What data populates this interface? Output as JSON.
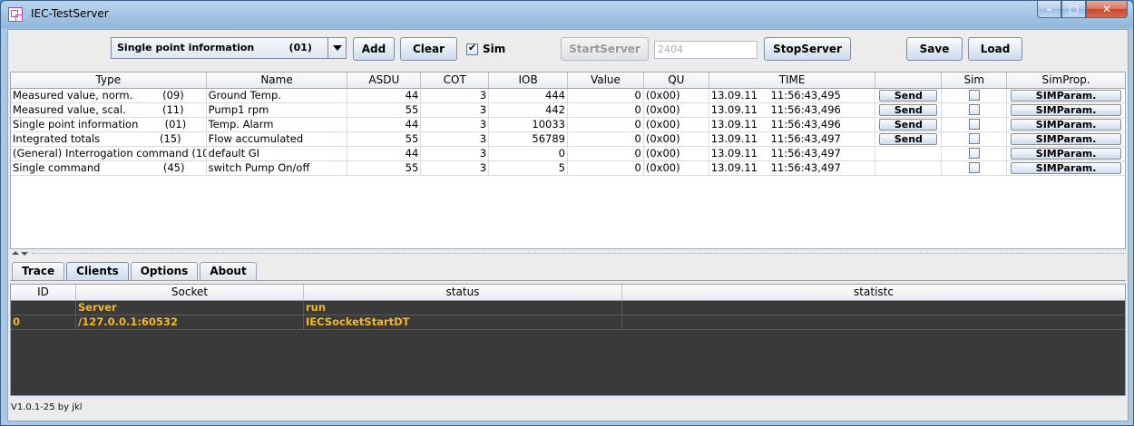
{
  "window": {
    "title": "IEC-TestServer",
    "controls": {
      "minimize": "–",
      "maximize": "□",
      "close": "✕"
    }
  },
  "toolbar": {
    "type_select": {
      "label": "Single point information",
      "code": "(01)"
    },
    "add_label": "Add",
    "clear_label": "Clear",
    "sim_label": "Sim",
    "sim_checked": true,
    "start_label": "StartServer",
    "port_value": "2404",
    "stop_label": "StopServer",
    "save_label": "Save",
    "load_label": "Load"
  },
  "table": {
    "headers": [
      "Type",
      "Name",
      "ASDU",
      "COT",
      "IOB",
      "Value",
      "QU",
      "TIME",
      "",
      "Sim",
      "SimProp."
    ],
    "rows": [
      {
        "type": "Measured value, norm.         (09)",
        "name": "Ground Temp.",
        "asdu": "44",
        "cot": "3",
        "iob": "444",
        "value": "0",
        "qu": "(0x00)",
        "time": "13.09.11    11:56:43,495",
        "send": "Send",
        "sim": false,
        "simprop": "SIMParam."
      },
      {
        "type": "Measured value, scal.           (11)",
        "name": "Pump1 rpm",
        "asdu": "55",
        "cot": "3",
        "iob": "442",
        "value": "0",
        "qu": "(0x00)",
        "time": "13.09.11    11:56:43,496",
        "send": "Send",
        "sim": false,
        "simprop": "SIMParam."
      },
      {
        "type": "Single point information        (01)",
        "name": "Temp. Alarm",
        "asdu": "44",
        "cot": "3",
        "iob": "10033",
        "value": "0",
        "qu": "(0x00)",
        "time": "13.09.11    11:56:43,496",
        "send": "Send",
        "sim": false,
        "simprop": "SIMParam."
      },
      {
        "type": "Integrated totals                  (15)",
        "name": "Flow accumulated",
        "asdu": "55",
        "cot": "3",
        "iob": "56789",
        "value": "0",
        "qu": "(0x00)",
        "time": "13.09.11    11:56:43,497",
        "send": "Send",
        "sim": false,
        "simprop": "SIMParam."
      },
      {
        "type": "(General) Interrogation command (10...",
        "name": "default GI",
        "asdu": "44",
        "cot": "3",
        "iob": "0",
        "value": "0",
        "qu": "(0x00)",
        "time": "13.09.11    11:56:43,497",
        "send": "",
        "sim": false,
        "simprop": "SIMParam."
      },
      {
        "type": "Single command                   (45)",
        "name": "switch Pump On/off",
        "asdu": "55",
        "cot": "3",
        "iob": "5",
        "value": "0",
        "qu": "(0x00)",
        "time": "13.09.11    11:56:43,497",
        "send": "",
        "sim": false,
        "simprop": "SIMParam."
      }
    ]
  },
  "tabs": [
    {
      "label": "Trace",
      "active": false
    },
    {
      "label": "Clients",
      "active": true
    },
    {
      "label": "Options",
      "active": false
    },
    {
      "label": "About",
      "active": false
    }
  ],
  "clients": {
    "headers": [
      "ID",
      "Socket",
      "status",
      "statistc"
    ],
    "rows": [
      {
        "id": "",
        "socket": "Server",
        "status": "run",
        "statistc": ""
      },
      {
        "id": "0",
        "socket": "/127.0.0.1:60532",
        "status": "IECSocketStartDT",
        "statistc": ""
      }
    ]
  },
  "statusbar": {
    "version": "V1.0.1-25 by jkl"
  }
}
